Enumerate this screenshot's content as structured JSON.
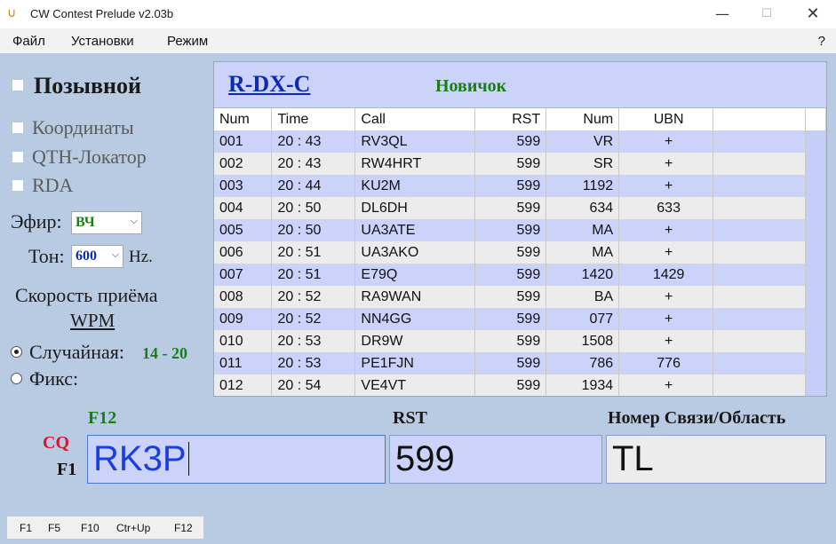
{
  "window": {
    "title": "CW Contest Prelude   v2.03b",
    "app_icon": "horseshoe-icon",
    "controls": {
      "minimize": "—",
      "maximize": "☐",
      "close": "✕"
    }
  },
  "menu": {
    "items": [
      "Файл",
      "Установки",
      "Режим"
    ],
    "help": "?"
  },
  "left": {
    "callsign_checkbox": "Позывной",
    "coords_checkbox": "Координаты",
    "qth_checkbox": "QTH-Локатор",
    "rda_checkbox": "RDA",
    "band_label": "Эфир:",
    "band_value": "ВЧ",
    "tone_label": "Тон:",
    "tone_value": "600",
    "tone_unit": "Hz.",
    "speed_label": "Скорость приёма",
    "wpm_link": "WPM",
    "random_label": "Случайная:",
    "random_range": "14 - 20",
    "fixed_label": "Фикс:",
    "speed_mode": "random"
  },
  "log": {
    "contest": "R-DX-C",
    "level": "Новичок",
    "columns": [
      "Num",
      "Time",
      "Call",
      "RST",
      "Num",
      "UBN"
    ],
    "rows": [
      [
        "001",
        "20 : 43",
        "RV3QL",
        "599",
        "VR",
        "+"
      ],
      [
        "002",
        "20 : 43",
        "RW4HRT",
        "599",
        "SR",
        "+"
      ],
      [
        "003",
        "20 : 44",
        "KU2M",
        "599",
        "1192",
        "+"
      ],
      [
        "004",
        "20 : 50",
        "DL6DH",
        "599",
        "634",
        "633"
      ],
      [
        "005",
        "20 : 50",
        "UA3ATE",
        "599",
        "MA",
        "+"
      ],
      [
        "006",
        "20 : 51",
        "UA3AKO",
        "599",
        "MA",
        "+"
      ],
      [
        "007",
        "20 : 51",
        "E79Q",
        "599",
        "1420",
        "1429"
      ],
      [
        "008",
        "20 : 52",
        "RA9WAN",
        "599",
        "BA",
        "+"
      ],
      [
        "009",
        "20 : 52",
        "NN4GG",
        "599",
        "077",
        "+"
      ],
      [
        "010",
        "20 : 53",
        "DR9W",
        "599",
        "1508",
        "+"
      ],
      [
        "011",
        "20 : 53",
        "PE1FJN",
        "599",
        "786",
        "776"
      ],
      [
        "012",
        "20 : 54",
        "VE4VT",
        "599",
        "1934",
        "+"
      ]
    ]
  },
  "entry": {
    "call_hotkey": "F12",
    "rst_header": "RST",
    "exchange_header": "Номер Связи/Область",
    "cq_label": "CQ",
    "f1_label": "F1",
    "call_value": "RK3P",
    "rst_value": "599",
    "exchange_value": "TL"
  },
  "fkeys": [
    "F1",
    "F5",
    "F10",
    "Ctr+Up",
    "F12"
  ],
  "colors": {
    "background": "#b9cbe3",
    "row_highlight": "#ccd3fb",
    "green": "#1a7d17",
    "red": "#d6162a",
    "blue": "#0b2bb3"
  }
}
